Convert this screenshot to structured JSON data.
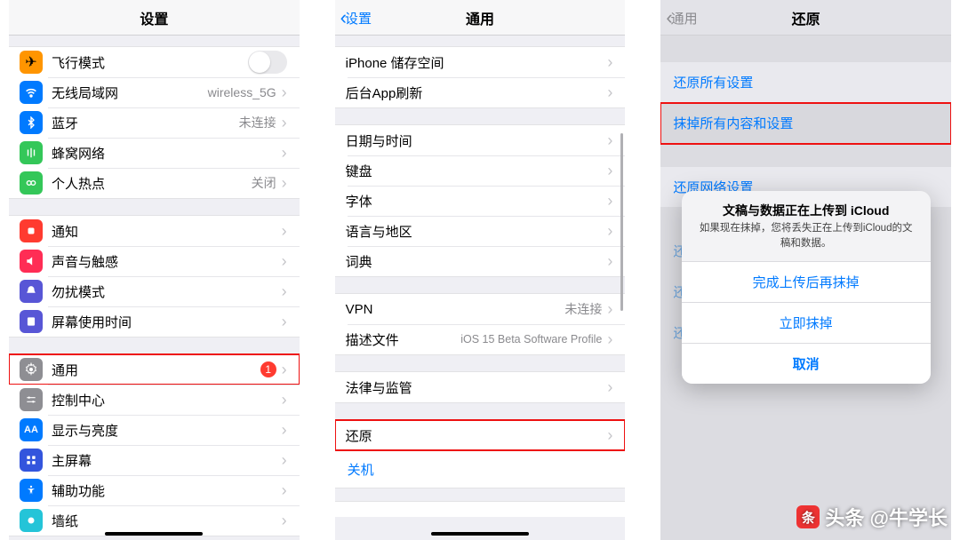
{
  "screen1": {
    "title": "设置",
    "rows": {
      "airplane": "飞行模式",
      "wifi": "无线局域网",
      "wifi_detail": "wireless_5G",
      "bt": "蓝牙",
      "bt_detail": "未连接",
      "cell": "蜂窝网络",
      "hotspot": "个人热点",
      "hotspot_detail": "关闭",
      "notif": "通知",
      "sound": "声音与触感",
      "dnd": "勿扰模式",
      "screentime": "屏幕使用时间",
      "general": "通用",
      "general_badge": "1",
      "control": "控制中心",
      "display": "显示与亮度",
      "home": "主屏幕",
      "access": "辅助功能",
      "wallpaper": "墙纸"
    }
  },
  "screen2": {
    "back": "设置",
    "title": "通用",
    "rows": {
      "storage": "iPhone 储存空间",
      "bgrefresh": "后台App刷新",
      "datetime": "日期与时间",
      "keyboard": "键盘",
      "font": "字体",
      "lang": "语言与地区",
      "dict": "词典",
      "vpn": "VPN",
      "vpn_detail": "未连接",
      "profile": "描述文件",
      "profile_detail": "iOS 15 Beta Software Profile",
      "legal": "法律与监管",
      "reset": "还原",
      "shutdown": "关机"
    }
  },
  "screen3": {
    "back": "通用",
    "title": "还原",
    "rows": {
      "r1": "还原所有设置",
      "r2": "抹掉所有内容和设置",
      "r3": "还原网络设置",
      "r4": "还原键",
      "r5": "还原主",
      "r6": "还原位"
    },
    "alert": {
      "title": "文稿与数据正在上传到 iCloud",
      "msg": "如果现在抹掉，您将丢失正在上传到iCloud的文稿和数据。",
      "b1": "完成上传后再抹掉",
      "b2": "立即抹掉",
      "b3": "取消"
    }
  },
  "watermark": "头条 @牛学长"
}
